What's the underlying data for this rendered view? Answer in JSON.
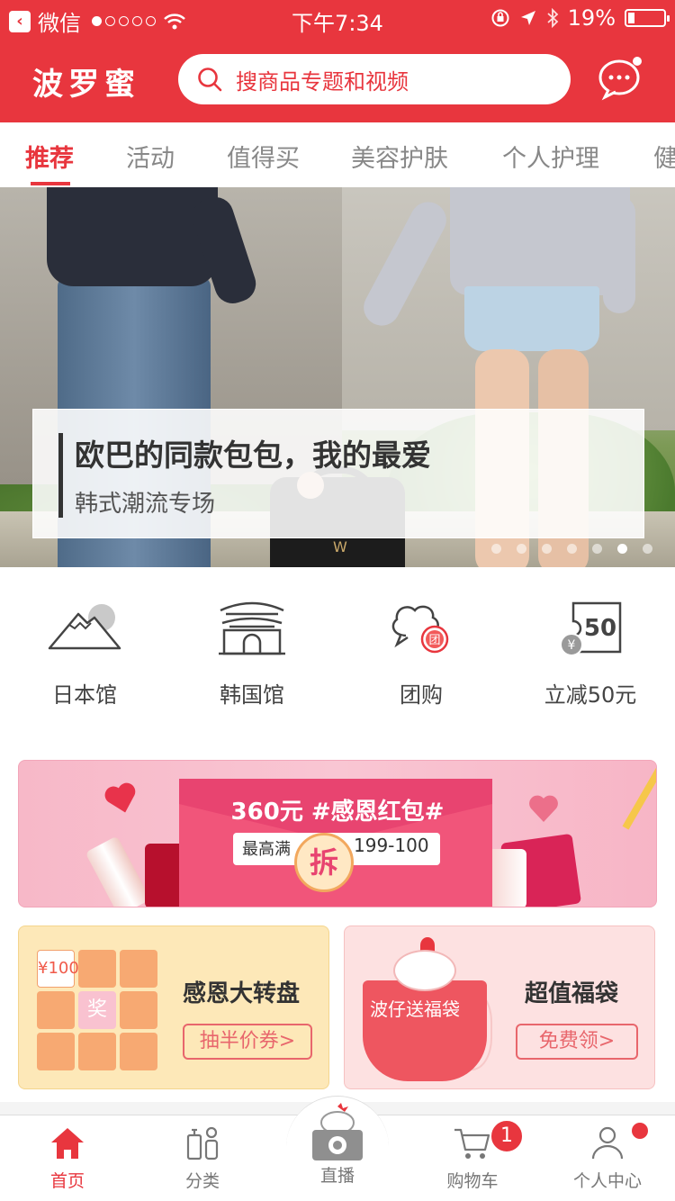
{
  "status_bar": {
    "carrier": "微信",
    "time": "下午7:34",
    "battery": "19%",
    "battery_level": 0.19
  },
  "header": {
    "logo": "波罗蜜",
    "search_placeholder": "搜商品专题和视频"
  },
  "tabs": [
    {
      "label": "推荐",
      "active": true
    },
    {
      "label": "活动"
    },
    {
      "label": "值得买"
    },
    {
      "label": "美容护肤"
    },
    {
      "label": "个人护理"
    },
    {
      "label": "健"
    }
  ],
  "banner": {
    "title": "欧巴的同款包包，我的最爱",
    "subtitle": "韩式潮流专场",
    "bag_letter": "W",
    "slide_count": 7,
    "active_slide": 6
  },
  "quick_links": [
    {
      "label": "日本馆",
      "icon": "mount-fuji-icon"
    },
    {
      "label": "韩国馆",
      "icon": "korean-gate-icon"
    },
    {
      "label": "团购",
      "icon": "group-buy-icon",
      "badge": "团"
    },
    {
      "label": "立减50元",
      "icon": "coupon-icon",
      "value": "50",
      "currency": "¥"
    }
  ],
  "promo": {
    "title": "360元 #感恩红包#",
    "left_text": "最高满",
    "right_text": "199-100",
    "button": "拆"
  },
  "cards": {
    "left": {
      "title": "感恩大转盘",
      "button": "抽半价券>",
      "grid_top_left": "¥100",
      "grid_center": "奖"
    },
    "right": {
      "title": "超值福袋",
      "button": "免费领>",
      "bag_text": "波仔送福袋"
    }
  },
  "tab_bar": [
    {
      "label": "首页",
      "icon": "home-icon",
      "active": true
    },
    {
      "label": "分类",
      "icon": "category-icon"
    },
    {
      "label": "直播",
      "icon": "live-camera-icon"
    },
    {
      "label": "购物车",
      "icon": "cart-icon",
      "badge": "1"
    },
    {
      "label": "个人中心",
      "icon": "profile-icon",
      "dot": true
    }
  ],
  "colors": {
    "brand_red": "#e8363e",
    "promo_pink": "#f7b8c8",
    "card_yellow": "#fde8b8",
    "card_pink": "#fde1e1"
  }
}
